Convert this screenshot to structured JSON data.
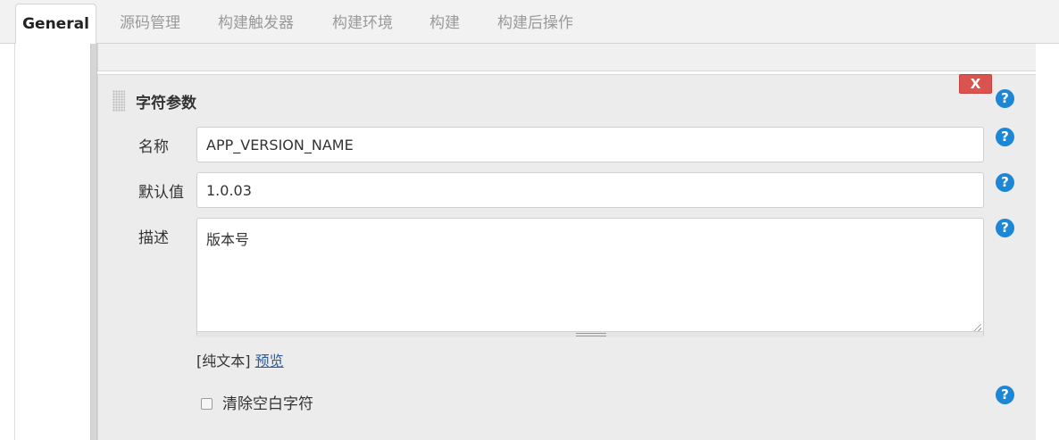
{
  "tabs": [
    {
      "label": "General"
    },
    {
      "label": "源码管理"
    },
    {
      "label": "构建触发器"
    },
    {
      "label": "构建环境"
    },
    {
      "label": "构建"
    },
    {
      "label": "构建后操作"
    }
  ],
  "param": {
    "title": "字符参数",
    "delete_label": "X",
    "help_label": "?",
    "name_label": "名称",
    "name_value": "APP_VERSION_NAME",
    "default_label": "默认值",
    "default_value": "1.0.03",
    "desc_label": "描述",
    "desc_value": "版本号",
    "format_plain": "[纯文本]",
    "preview_link": "预览",
    "trim_label": "清除空白字符",
    "trim_checked": false
  },
  "colors": {
    "help": "#1c87d6",
    "delete": "#d9534f",
    "link": "#2a5b9c"
  }
}
